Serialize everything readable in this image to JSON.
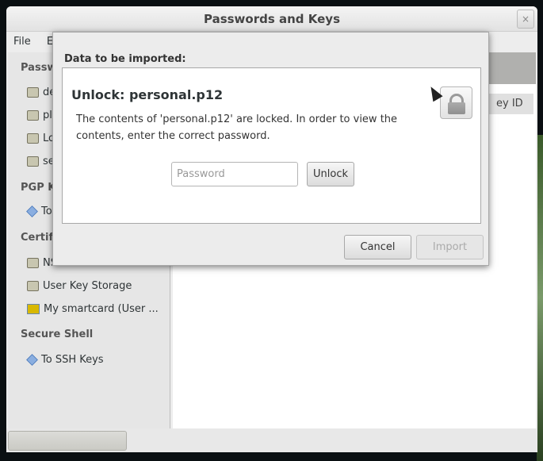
{
  "window": {
    "title": "Passwords and Keys",
    "close": "×"
  },
  "menubar": {
    "items": [
      "File",
      "E"
    ]
  },
  "sidebar": {
    "passwords_heading": "Passw",
    "password_items": [
      "de",
      "pl",
      "Lo",
      "se"
    ],
    "pgp_heading": "PGP K",
    "pgp_items": [
      "To"
    ],
    "cert_heading": "Certif",
    "cert_items": [
      "NSS Certificate DB",
      "User Key Storage",
      "My smartcard (User ..."
    ],
    "ssh_heading": "Secure Shell",
    "ssh_items": [
      "To SSH Keys"
    ]
  },
  "right_pane": {
    "column_header": "ey ID"
  },
  "dialog": {
    "section_label": "Data to be imported:",
    "heading": "Unlock: personal.p12",
    "message": "The contents of 'personal.p12' are locked. In order to view the contents, enter the correct password.",
    "password_placeholder": "Password",
    "unlock_label": "Unlock",
    "cancel_label": "Cancel",
    "import_label": "Import"
  }
}
